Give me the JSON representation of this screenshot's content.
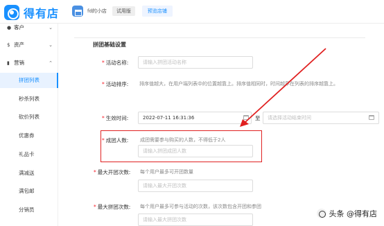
{
  "header": {
    "logo_text": "得有店",
    "shop_name": "fd的小店",
    "trial_badge": "试用版",
    "preview_button": "预览店铺"
  },
  "sidebar": {
    "top_items": [
      {
        "label": "客户",
        "icon": "users-icon"
      },
      {
        "label": "资产",
        "icon": "dollar-icon"
      },
      {
        "label": "营销",
        "icon": "chart-icon"
      }
    ],
    "sub_items": [
      {
        "label": "拼团列表",
        "active": true
      },
      {
        "label": "秒杀列表"
      },
      {
        "label": "砍价列表"
      },
      {
        "label": "优惠券"
      },
      {
        "label": "礼品卡"
      },
      {
        "label": "满减送"
      },
      {
        "label": "满包邮"
      },
      {
        "label": "分销员"
      }
    ]
  },
  "form": {
    "section_title": "拼团基础设置",
    "name": {
      "label": "活动名称:",
      "placeholder": "请输入拼团活动名称"
    },
    "sort": {
      "label": "活动排序:",
      "hint": "排序值越大，在用户端列表中的位置越靠上。排序值相同时，时间越早在列表的排序越靠上。"
    },
    "time": {
      "label": "生效时间:",
      "start_value": "2022-07-11 16:31:36",
      "to_text": "至",
      "end_placeholder": "请选择活动结束时间"
    },
    "group_size": {
      "label": "成团人数:",
      "hint": "成团需要参与购买的人数，不得低于2人",
      "placeholder": "请输入拼团成团人数"
    },
    "max_open": {
      "label": "最大开团次数:",
      "hint": "每个用户最多可开团数量",
      "placeholder": "请输入最大开团次数"
    },
    "max_join": {
      "label": "最大拼团次数:",
      "hint": "每个用户最多可参与活动的次数，该次数包含开团和参团",
      "placeholder": "请输入最大拼团次数"
    }
  },
  "watermark": "头条 @得有店",
  "colors": {
    "brand": "#1890ff",
    "annotation": "#e02020",
    "required": "#f5222d"
  }
}
